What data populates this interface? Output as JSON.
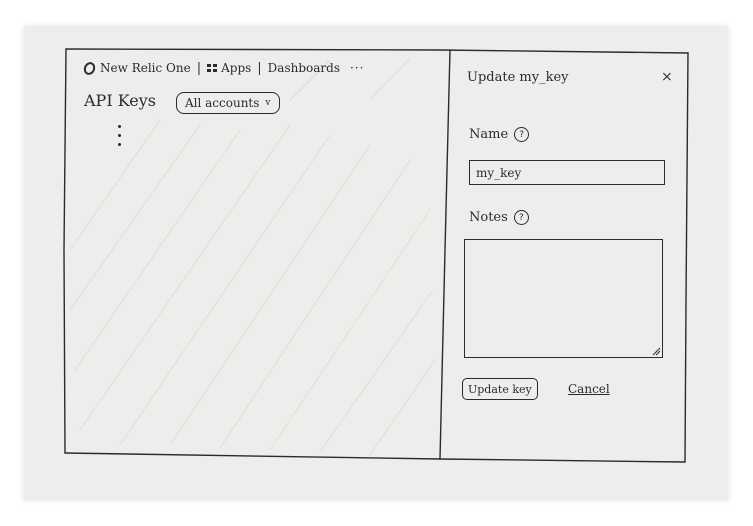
{
  "nav": {
    "brand": "New Relic One",
    "apps_label": "Apps",
    "dashboards_label": "Dashboards",
    "more_label": "···",
    "separator": "|"
  },
  "page": {
    "title": "API Keys",
    "account_filter": "All accounts",
    "account_filter_chevron": "v"
  },
  "panel": {
    "title": "Update my_key",
    "close_label": "×",
    "name_label": "Name",
    "name_value": "my_key",
    "notes_label": "Notes",
    "notes_value": "",
    "help_glyph": "?",
    "update_button": "Update key",
    "cancel_link": "Cancel"
  }
}
